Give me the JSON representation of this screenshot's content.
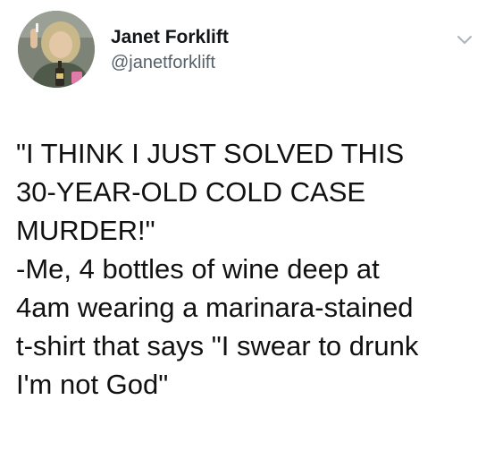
{
  "tweet": {
    "author": {
      "display_name": "Janet Forklift",
      "handle": "@janetforklift"
    },
    "menu_icon": "chevron-down-icon",
    "text_lines": [
      "\"I THINK I JUST SOLVED THIS",
      "30-YEAR-OLD COLD CASE",
      "MURDER!\"",
      "-Me, 4 bottles of wine deep at",
      "4am wearing a marinara-stained",
      "t-shirt that says \"I swear to drunk",
      "I'm not God\""
    ]
  },
  "colors": {
    "text": "#111111",
    "handle": "#55606a",
    "caret": "#aab2ba",
    "background": "#ffffff"
  }
}
